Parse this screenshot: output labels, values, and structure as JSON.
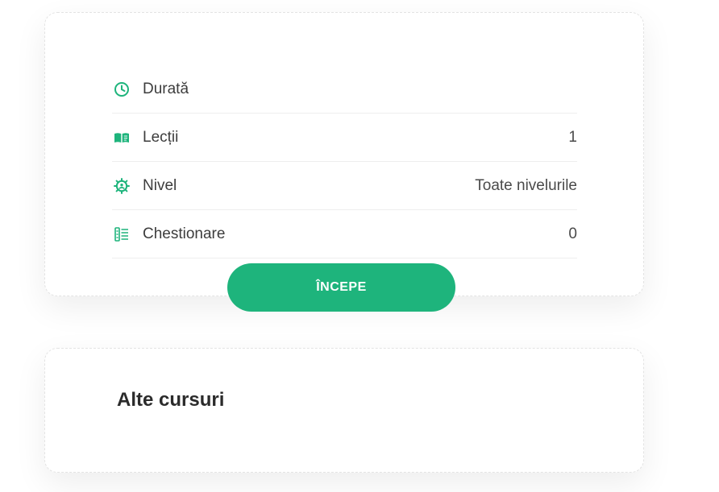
{
  "course_info": {
    "rows": [
      {
        "icon": "clock-icon",
        "label": "Durată",
        "value": ""
      },
      {
        "icon": "book-icon",
        "label": "Lecții",
        "value": "1"
      },
      {
        "icon": "level-icon",
        "label": "Nivel",
        "value": "Toate nivelurile"
      },
      {
        "icon": "quiz-list-icon",
        "label": "Chestionare",
        "value": "0"
      }
    ],
    "start_button_label": "ÎNCEPE"
  },
  "other_courses": {
    "title": "Alte cursuri"
  },
  "colors": {
    "accent": "#1eb47c",
    "icon": "#1eb47c"
  }
}
